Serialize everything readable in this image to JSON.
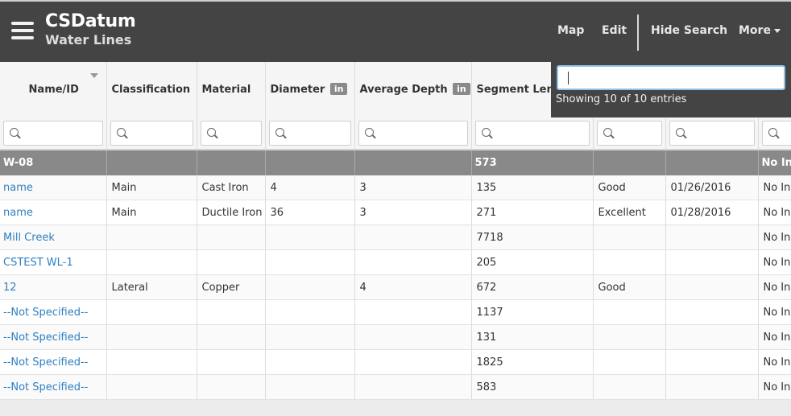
{
  "header": {
    "app_title": "CSDatum",
    "subtitle": "Water Lines",
    "nav": {
      "map": "Map",
      "edit": "Edit",
      "hide_search": "Hide Search",
      "more": "More"
    },
    "colors": {
      "bar": "#444444",
      "link": "#2f7fc1",
      "group_row": "#898989"
    }
  },
  "search": {
    "value": "",
    "info": "Showing 10 of 10 entries"
  },
  "table": {
    "columns": [
      {
        "label": "Name/ID",
        "unit": ""
      },
      {
        "label": "Classification",
        "unit": ""
      },
      {
        "label": "Material",
        "unit": ""
      },
      {
        "label": "Diameter",
        "unit": "in"
      },
      {
        "label": "Average Depth",
        "unit": "in"
      },
      {
        "label": "Segment Length",
        "unit": ""
      },
      {
        "label": "",
        "unit": ""
      },
      {
        "label": "",
        "unit": ""
      },
      {
        "label": "",
        "unit": ""
      }
    ],
    "group": {
      "name": "W-08",
      "segment_length": "573",
      "last": "No Ins"
    },
    "rows": [
      [
        "name",
        "Main",
        "Cast Iron",
        "4",
        "3",
        "135",
        "Good",
        "01/26/2016",
        "No Ins"
      ],
      [
        "name",
        "Main",
        "Ductile Iron",
        "36",
        "3",
        "271",
        "Excellent",
        "01/28/2016",
        "No Ins"
      ],
      [
        "Mill Creek",
        "",
        "",
        "",
        "",
        "7718",
        "",
        "",
        "No Ins"
      ],
      [
        "CSTEST WL-1",
        "",
        "",
        "",
        "",
        "205",
        "",
        "",
        "No Ins"
      ],
      [
        "12",
        "Lateral",
        "Copper",
        "",
        "4",
        "672",
        "Good",
        "",
        "No Ins"
      ],
      [
        "--Not Specified--",
        "",
        "",
        "",
        "",
        "1137",
        "",
        "",
        "No Ins"
      ],
      [
        "--Not Specified--",
        "",
        "",
        "",
        "",
        "131",
        "",
        "",
        "No Ins"
      ],
      [
        "--Not Specified--",
        "",
        "",
        "",
        "",
        "1825",
        "",
        "",
        "No Ins"
      ],
      [
        "--Not Specified--",
        "",
        "",
        "",
        "",
        "583",
        "",
        "",
        "No Ins"
      ]
    ]
  }
}
